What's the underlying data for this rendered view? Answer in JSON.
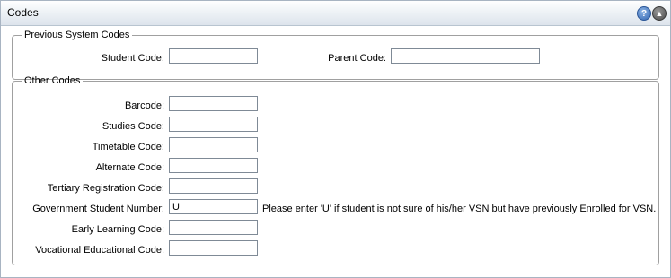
{
  "header": {
    "title": "Codes",
    "help_icon": "help-icon",
    "collapse_icon": "collapse-up-icon"
  },
  "previous_system_codes": {
    "legend": "Previous System Codes",
    "student_code": {
      "label": "Student Code:",
      "value": ""
    },
    "parent_code": {
      "label": "Parent Code:",
      "value": ""
    }
  },
  "other_codes": {
    "legend": "Other Codes",
    "barcode": {
      "label": "Barcode:",
      "value": ""
    },
    "studies_code": {
      "label": "Studies Code:",
      "value": ""
    },
    "timetable_code": {
      "label": "Timetable Code:",
      "value": ""
    },
    "alternate_code": {
      "label": "Alternate Code:",
      "value": ""
    },
    "tertiary_registration_code": {
      "label": "Tertiary Registration Code:",
      "value": ""
    },
    "government_student_number": {
      "label": "Government Student Number:",
      "value": "U",
      "hint": "Please enter 'U' if student is not sure of his/her VSN but have previously Enrolled for VSN."
    },
    "early_learning_code": {
      "label": "Early Learning Code:",
      "value": ""
    },
    "vocational_educational_code": {
      "label": "Vocational Educational Code:",
      "value": ""
    }
  }
}
